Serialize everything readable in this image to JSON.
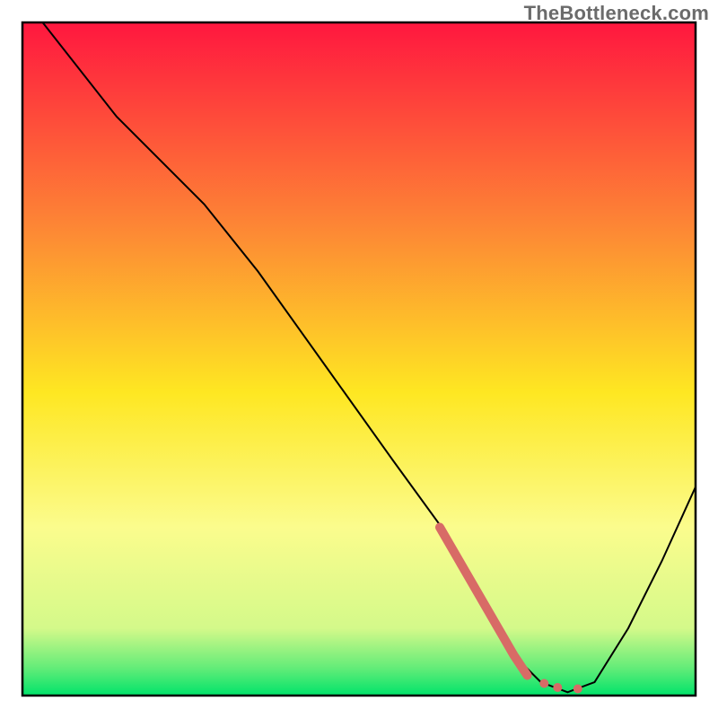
{
  "watermark": "TheBottleneck.com",
  "chart_data": {
    "type": "line",
    "title": "",
    "xlabel": "",
    "ylabel": "",
    "xlim": [
      0,
      100
    ],
    "ylim": [
      0,
      100
    ],
    "grid": false,
    "legend": false,
    "annotations": [],
    "background_gradient": {
      "stops": [
        {
          "offset": 0.0,
          "color": "#ff173f"
        },
        {
          "offset": 0.3,
          "color": "#fd8535"
        },
        {
          "offset": 0.55,
          "color": "#fee722"
        },
        {
          "offset": 0.75,
          "color": "#fbfc8d"
        },
        {
          "offset": 0.9,
          "color": "#d4f98a"
        },
        {
          "offset": 0.96,
          "color": "#61ec78"
        },
        {
          "offset": 1.0,
          "color": "#00e36a"
        }
      ]
    },
    "series": [
      {
        "name": "black-curve",
        "color": "#000000",
        "stroke_width": 2,
        "type": "line",
        "points": [
          {
            "x": 3.0,
            "y": 100.0
          },
          {
            "x": 14.0,
            "y": 86.0
          },
          {
            "x": 27.0,
            "y": 73.0
          },
          {
            "x": 35.0,
            "y": 63.0
          },
          {
            "x": 45.0,
            "y": 49.0
          },
          {
            "x": 55.0,
            "y": 35.0
          },
          {
            "x": 63.0,
            "y": 24.0
          },
          {
            "x": 69.0,
            "y": 13.0
          },
          {
            "x": 73.0,
            "y": 6.0
          },
          {
            "x": 77.0,
            "y": 2.0
          },
          {
            "x": 81.0,
            "y": 0.5
          },
          {
            "x": 85.0,
            "y": 2.0
          },
          {
            "x": 90.0,
            "y": 10.0
          },
          {
            "x": 95.0,
            "y": 20.0
          },
          {
            "x": 100.0,
            "y": 31.0
          }
        ]
      },
      {
        "name": "highlight-descent",
        "color": "#d86b66",
        "stroke_width": 10,
        "type": "line",
        "linecap": "round",
        "points": [
          {
            "x": 62.0,
            "y": 25.0
          },
          {
            "x": 73.0,
            "y": 6.0
          },
          {
            "x": 75.0,
            "y": 3.0
          }
        ]
      },
      {
        "name": "highlight-dots",
        "color": "#d86b66",
        "type": "scatter",
        "marker_size": 10,
        "points": [
          {
            "x": 77.5,
            "y": 1.8
          },
          {
            "x": 79.5,
            "y": 1.2
          },
          {
            "x": 82.5,
            "y": 1.0
          }
        ]
      }
    ]
  }
}
